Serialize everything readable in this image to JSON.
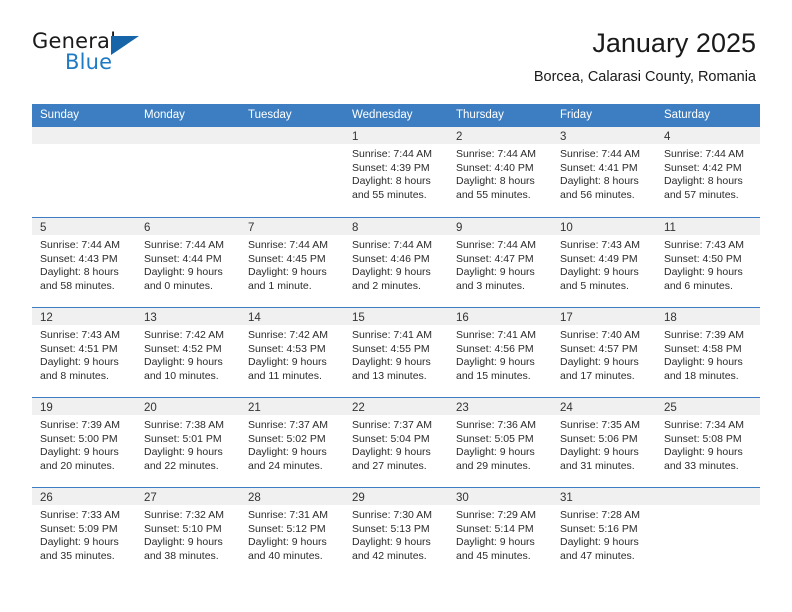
{
  "logo": {
    "word_one": "General",
    "word_two": "Blue",
    "triangle": "blue-triangle-icon"
  },
  "header": {
    "title": "January 2025",
    "subtitle": "Borcea, Calarasi County, Romania"
  },
  "colors": {
    "header_blue": "#3c7ec1",
    "logo_blue": "#1f7ac4",
    "band_gray": "#f0f0f0"
  },
  "weekdays": [
    "Sunday",
    "Monday",
    "Tuesday",
    "Wednesday",
    "Thursday",
    "Friday",
    "Saturday"
  ],
  "weeks": [
    [
      {
        "day": "",
        "empty": true
      },
      {
        "day": "",
        "empty": true
      },
      {
        "day": "",
        "empty": true
      },
      {
        "day": "1",
        "sunrise": "Sunrise: 7:44 AM",
        "sunset": "Sunset: 4:39 PM",
        "daylight_line1": "Daylight: 8 hours",
        "daylight_line2": "and 55 minutes."
      },
      {
        "day": "2",
        "sunrise": "Sunrise: 7:44 AM",
        "sunset": "Sunset: 4:40 PM",
        "daylight_line1": "Daylight: 8 hours",
        "daylight_line2": "and 55 minutes."
      },
      {
        "day": "3",
        "sunrise": "Sunrise: 7:44 AM",
        "sunset": "Sunset: 4:41 PM",
        "daylight_line1": "Daylight: 8 hours",
        "daylight_line2": "and 56 minutes."
      },
      {
        "day": "4",
        "sunrise": "Sunrise: 7:44 AM",
        "sunset": "Sunset: 4:42 PM",
        "daylight_line1": "Daylight: 8 hours",
        "daylight_line2": "and 57 minutes."
      }
    ],
    [
      {
        "day": "5",
        "sunrise": "Sunrise: 7:44 AM",
        "sunset": "Sunset: 4:43 PM",
        "daylight_line1": "Daylight: 8 hours",
        "daylight_line2": "and 58 minutes."
      },
      {
        "day": "6",
        "sunrise": "Sunrise: 7:44 AM",
        "sunset": "Sunset: 4:44 PM",
        "daylight_line1": "Daylight: 9 hours",
        "daylight_line2": "and 0 minutes."
      },
      {
        "day": "7",
        "sunrise": "Sunrise: 7:44 AM",
        "sunset": "Sunset: 4:45 PM",
        "daylight_line1": "Daylight: 9 hours",
        "daylight_line2": "and 1 minute."
      },
      {
        "day": "8",
        "sunrise": "Sunrise: 7:44 AM",
        "sunset": "Sunset: 4:46 PM",
        "daylight_line1": "Daylight: 9 hours",
        "daylight_line2": "and 2 minutes."
      },
      {
        "day": "9",
        "sunrise": "Sunrise: 7:44 AM",
        "sunset": "Sunset: 4:47 PM",
        "daylight_line1": "Daylight: 9 hours",
        "daylight_line2": "and 3 minutes."
      },
      {
        "day": "10",
        "sunrise": "Sunrise: 7:43 AM",
        "sunset": "Sunset: 4:49 PM",
        "daylight_line1": "Daylight: 9 hours",
        "daylight_line2": "and 5 minutes."
      },
      {
        "day": "11",
        "sunrise": "Sunrise: 7:43 AM",
        "sunset": "Sunset: 4:50 PM",
        "daylight_line1": "Daylight: 9 hours",
        "daylight_line2": "and 6 minutes."
      }
    ],
    [
      {
        "day": "12",
        "sunrise": "Sunrise: 7:43 AM",
        "sunset": "Sunset: 4:51 PM",
        "daylight_line1": "Daylight: 9 hours",
        "daylight_line2": "and 8 minutes."
      },
      {
        "day": "13",
        "sunrise": "Sunrise: 7:42 AM",
        "sunset": "Sunset: 4:52 PM",
        "daylight_line1": "Daylight: 9 hours",
        "daylight_line2": "and 10 minutes."
      },
      {
        "day": "14",
        "sunrise": "Sunrise: 7:42 AM",
        "sunset": "Sunset: 4:53 PM",
        "daylight_line1": "Daylight: 9 hours",
        "daylight_line2": "and 11 minutes."
      },
      {
        "day": "15",
        "sunrise": "Sunrise: 7:41 AM",
        "sunset": "Sunset: 4:55 PM",
        "daylight_line1": "Daylight: 9 hours",
        "daylight_line2": "and 13 minutes."
      },
      {
        "day": "16",
        "sunrise": "Sunrise: 7:41 AM",
        "sunset": "Sunset: 4:56 PM",
        "daylight_line1": "Daylight: 9 hours",
        "daylight_line2": "and 15 minutes."
      },
      {
        "day": "17",
        "sunrise": "Sunrise: 7:40 AM",
        "sunset": "Sunset: 4:57 PM",
        "daylight_line1": "Daylight: 9 hours",
        "daylight_line2": "and 17 minutes."
      },
      {
        "day": "18",
        "sunrise": "Sunrise: 7:39 AM",
        "sunset": "Sunset: 4:58 PM",
        "daylight_line1": "Daylight: 9 hours",
        "daylight_line2": "and 18 minutes."
      }
    ],
    [
      {
        "day": "19",
        "sunrise": "Sunrise: 7:39 AM",
        "sunset": "Sunset: 5:00 PM",
        "daylight_line1": "Daylight: 9 hours",
        "daylight_line2": "and 20 minutes."
      },
      {
        "day": "20",
        "sunrise": "Sunrise: 7:38 AM",
        "sunset": "Sunset: 5:01 PM",
        "daylight_line1": "Daylight: 9 hours",
        "daylight_line2": "and 22 minutes."
      },
      {
        "day": "21",
        "sunrise": "Sunrise: 7:37 AM",
        "sunset": "Sunset: 5:02 PM",
        "daylight_line1": "Daylight: 9 hours",
        "daylight_line2": "and 24 minutes."
      },
      {
        "day": "22",
        "sunrise": "Sunrise: 7:37 AM",
        "sunset": "Sunset: 5:04 PM",
        "daylight_line1": "Daylight: 9 hours",
        "daylight_line2": "and 27 minutes."
      },
      {
        "day": "23",
        "sunrise": "Sunrise: 7:36 AM",
        "sunset": "Sunset: 5:05 PM",
        "daylight_line1": "Daylight: 9 hours",
        "daylight_line2": "and 29 minutes."
      },
      {
        "day": "24",
        "sunrise": "Sunrise: 7:35 AM",
        "sunset": "Sunset: 5:06 PM",
        "daylight_line1": "Daylight: 9 hours",
        "daylight_line2": "and 31 minutes."
      },
      {
        "day": "25",
        "sunrise": "Sunrise: 7:34 AM",
        "sunset": "Sunset: 5:08 PM",
        "daylight_line1": "Daylight: 9 hours",
        "daylight_line2": "and 33 minutes."
      }
    ],
    [
      {
        "day": "26",
        "sunrise": "Sunrise: 7:33 AM",
        "sunset": "Sunset: 5:09 PM",
        "daylight_line1": "Daylight: 9 hours",
        "daylight_line2": "and 35 minutes."
      },
      {
        "day": "27",
        "sunrise": "Sunrise: 7:32 AM",
        "sunset": "Sunset: 5:10 PM",
        "daylight_line1": "Daylight: 9 hours",
        "daylight_line2": "and 38 minutes."
      },
      {
        "day": "28",
        "sunrise": "Sunrise: 7:31 AM",
        "sunset": "Sunset: 5:12 PM",
        "daylight_line1": "Daylight: 9 hours",
        "daylight_line2": "and 40 minutes."
      },
      {
        "day": "29",
        "sunrise": "Sunrise: 7:30 AM",
        "sunset": "Sunset: 5:13 PM",
        "daylight_line1": "Daylight: 9 hours",
        "daylight_line2": "and 42 minutes."
      },
      {
        "day": "30",
        "sunrise": "Sunrise: 7:29 AM",
        "sunset": "Sunset: 5:14 PM",
        "daylight_line1": "Daylight: 9 hours",
        "daylight_line2": "and 45 minutes."
      },
      {
        "day": "31",
        "sunrise": "Sunrise: 7:28 AM",
        "sunset": "Sunset: 5:16 PM",
        "daylight_line1": "Daylight: 9 hours",
        "daylight_line2": "and 47 minutes."
      },
      {
        "day": "",
        "empty": true
      }
    ]
  ]
}
